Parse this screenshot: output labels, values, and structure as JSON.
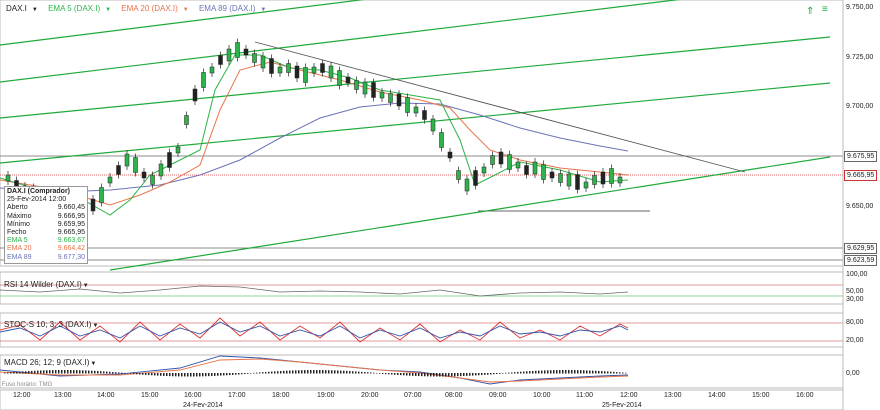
{
  "toolbar": {
    "symbol": "DAX.I",
    "ema5": "EMA 5 (DAX.I)",
    "ema20": "EMA 20 (DAX.I)",
    "ema89": "EMA 89 (DAX.I)",
    "dropdown": "▼",
    "ema5_color": "#2db34a",
    "ema20_color": "#e8744a",
    "ema89_color": "#6b74b8"
  },
  "price_axis": [
    "9.750,00",
    "9.725,00",
    "9.700,00",
    "9.675,95",
    "9.665,95",
    "9.650,00",
    "9.629,95",
    "9.623,59"
  ],
  "info_box": {
    "title": "DAX.I (Comprador)",
    "date": "25-Fev-2014 12:00",
    "rows": [
      {
        "label": "Aberto",
        "value": "9.660,45"
      },
      {
        "label": "Máximo",
        "value": "9.666,95"
      },
      {
        "label": "Mínimo",
        "value": "9.659,95"
      },
      {
        "label": "Fecho",
        "value": "9.665,95"
      },
      {
        "label": "EMA 5",
        "value": "9.663,67"
      },
      {
        "label": "EMA 20",
        "value": "9.664,42"
      },
      {
        "label": "EMA 89",
        "value": "9.677,30"
      }
    ]
  },
  "rsi": {
    "label": "RSI 14 Wilder (DAX.I)",
    "axis": [
      "100,00",
      "50,00",
      "30,00"
    ]
  },
  "stoc": {
    "label": "STOC-S 10; 3; 3 (DAX.I)",
    "axis": [
      "80,00",
      "20,00"
    ]
  },
  "macd": {
    "label": "MACD 26; 12; 9 (DAX.I)",
    "axis": [
      "0,00"
    ]
  },
  "time_axis": {
    "labels": [
      "12:00",
      "13:00",
      "14:00",
      "15:00",
      "16:00",
      "17:00",
      "18:00",
      "19:00",
      "20:00",
      "07:00",
      "08:00",
      "09:00",
      "10:00",
      "11:00",
      "12:00",
      "13:00",
      "14:00",
      "15:00",
      "16:00"
    ],
    "day1": "24-Fev-2014",
    "day2": "25-Fev-2014"
  },
  "watermark": "Fuso horário: TMG"
}
